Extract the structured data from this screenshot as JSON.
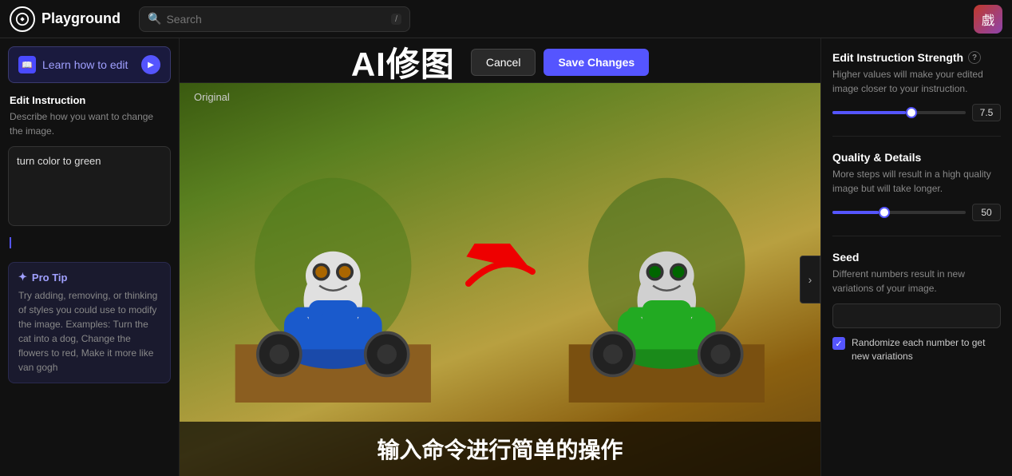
{
  "topbar": {
    "logo_text": "Playground",
    "search_placeholder": "Search",
    "search_kbd": "/",
    "avatar_emoji": "戲"
  },
  "left_sidebar": {
    "learn_btn_label": "Learn how to edit",
    "learn_btn_icon": "📖",
    "section_title": "Edit Instruction",
    "section_desc": "Describe how you want to change the image.",
    "instruction_value": "turn color to green",
    "pro_tip_header": "Pro Tip",
    "pro_tip_text": "Try adding, removing, or thinking of styles you could use to modify the image. Examples: Turn the cat into a dog, Change the flowers to red, Make it more like van gogh"
  },
  "center": {
    "title": "AI修图",
    "cancel_label": "Cancel",
    "save_label": "Save Changes",
    "original_label": "Original",
    "subtitle": "输入命令进行简单的操作"
  },
  "right_sidebar": {
    "strength_title": "Edit Instruction Strength",
    "strength_desc": "Higher values will make your edited image closer to your instruction.",
    "strength_value": "7.5",
    "strength_percent": 55,
    "quality_title": "Quality & Details",
    "quality_desc": "More steps will result in a high quality image but will take longer.",
    "quality_value": "50",
    "quality_percent": 35,
    "seed_title": "Seed",
    "seed_desc": "Different numbers result in new variations of your image.",
    "seed_value": "",
    "randomize_label": "Randomize each number to get new variations",
    "randomize_checked": true,
    "info_icon_label": "?"
  }
}
